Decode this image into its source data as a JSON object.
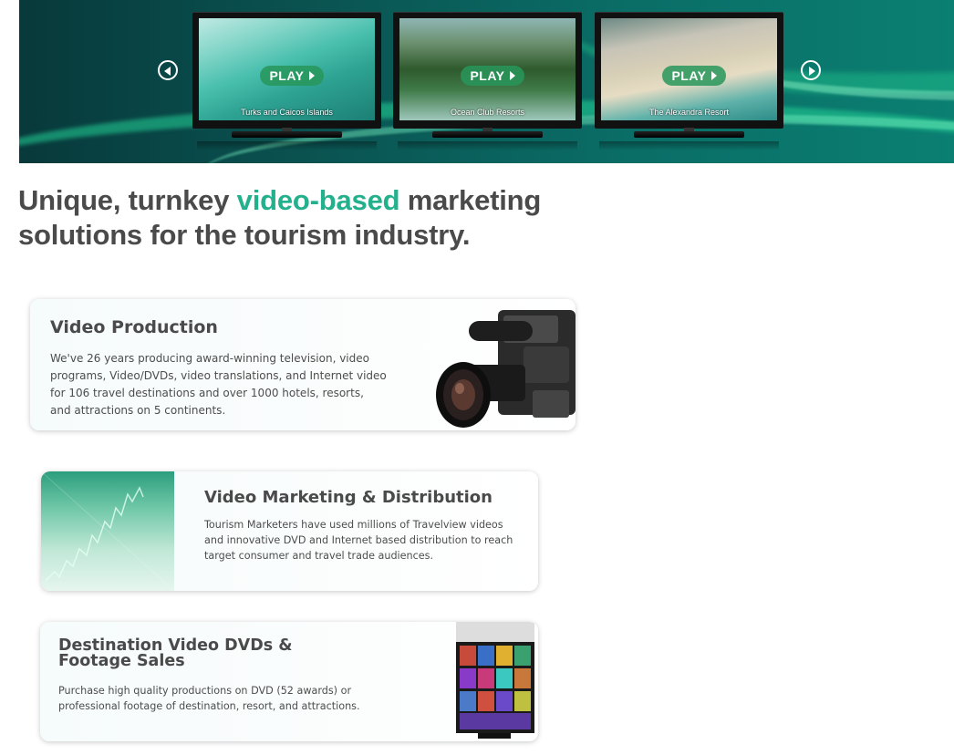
{
  "banner": {
    "tvs": [
      {
        "play_label": "PLAY",
        "caption": "Turks and Caicos Islands"
      },
      {
        "play_label": "PLAY",
        "caption": "Ocean Club Resorts"
      },
      {
        "play_label": "PLAY",
        "caption": "The Alexandra Resort"
      }
    ],
    "prev_icon": "circle-arrow-left",
    "next_icon": "circle-arrow-right"
  },
  "headline": {
    "part1": "Unique, turnkey ",
    "highlight": "video-based",
    "part2": " marketing",
    "line2": "solutions for the tourism industry.",
    "highlight_color": "#23b08c"
  },
  "cards": [
    {
      "title": "Video Production",
      "body": "We've 26 years producing award-winning television, video programs, Video/DVDs, video translations, and Internet video for 106 travel destinations and over 1000 hotels, resorts, and attractions on 5 continents.",
      "image": "video-camera"
    },
    {
      "title": "Video Marketing & Distribution",
      "body": "Tourism Marketers have used millions of Travelview videos and innovative DVD and Internet based distribution to reach target consumer and travel trade audiences.",
      "image": "growth-chart"
    },
    {
      "title": "Destination Video DVDs & Footage Sales",
      "body": "Purchase high quality productions on DVD (52 awards) or professional footage of destination, resort, and attractions.",
      "image": "dvd-rack"
    }
  ]
}
